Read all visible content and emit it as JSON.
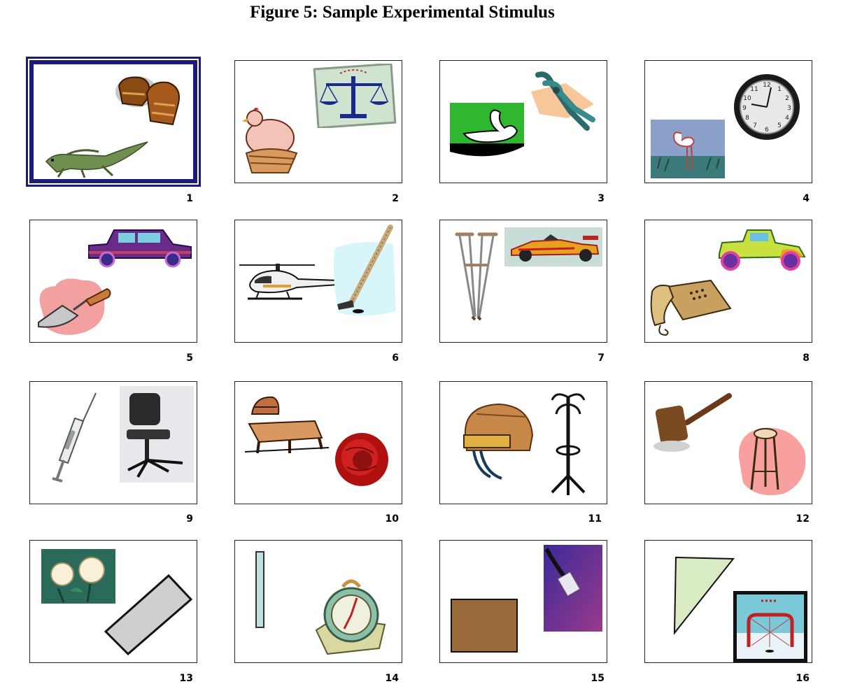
{
  "title": "Figure 5: Sample Experimental Stimulus",
  "selected_card": "1",
  "selection_color": "#1a1a80",
  "cards": [
    {
      "number": "1",
      "images": [
        "hockey-gloves-icon",
        "iguana-icon"
      ]
    },
    {
      "number": "2",
      "images": [
        "hen-on-nest-icon",
        "scales-of-justice-icon"
      ]
    },
    {
      "number": "3",
      "images": [
        "swan-icon",
        "pliers-icon"
      ]
    },
    {
      "number": "4",
      "images": [
        "flamingo-icon",
        "wall-clock-icon"
      ]
    },
    {
      "number": "5",
      "images": [
        "limousine-icon",
        "trowel-icon"
      ]
    },
    {
      "number": "6",
      "images": [
        "helicopter-icon",
        "hockey-stick-icon"
      ]
    },
    {
      "number": "7",
      "images": [
        "crutches-icon",
        "race-car-icon"
      ]
    },
    {
      "number": "8",
      "images": [
        "vintage-car-icon",
        "fax-phone-icon"
      ]
    },
    {
      "number": "9",
      "images": [
        "syringe-icon",
        "office-chair-icon"
      ]
    },
    {
      "number": "10",
      "images": [
        "deck-chair-icon",
        "red-flower-icon"
      ]
    },
    {
      "number": "11",
      "images": [
        "hockey-helmet-icon",
        "coat-rack-icon"
      ]
    },
    {
      "number": "12",
      "images": [
        "gavel-icon",
        "bar-stool-icon"
      ]
    },
    {
      "number": "13",
      "images": [
        "white-roses-icon",
        "gray-rectangle-shape"
      ]
    },
    {
      "number": "14",
      "images": [
        "thin-bar-shape",
        "kitchen-timer-icon"
      ]
    },
    {
      "number": "15",
      "images": [
        "brown-square-shape",
        "network-cable-icon"
      ]
    },
    {
      "number": "16",
      "images": [
        "green-triangle-shape",
        "hockey-net-icon"
      ]
    }
  ]
}
